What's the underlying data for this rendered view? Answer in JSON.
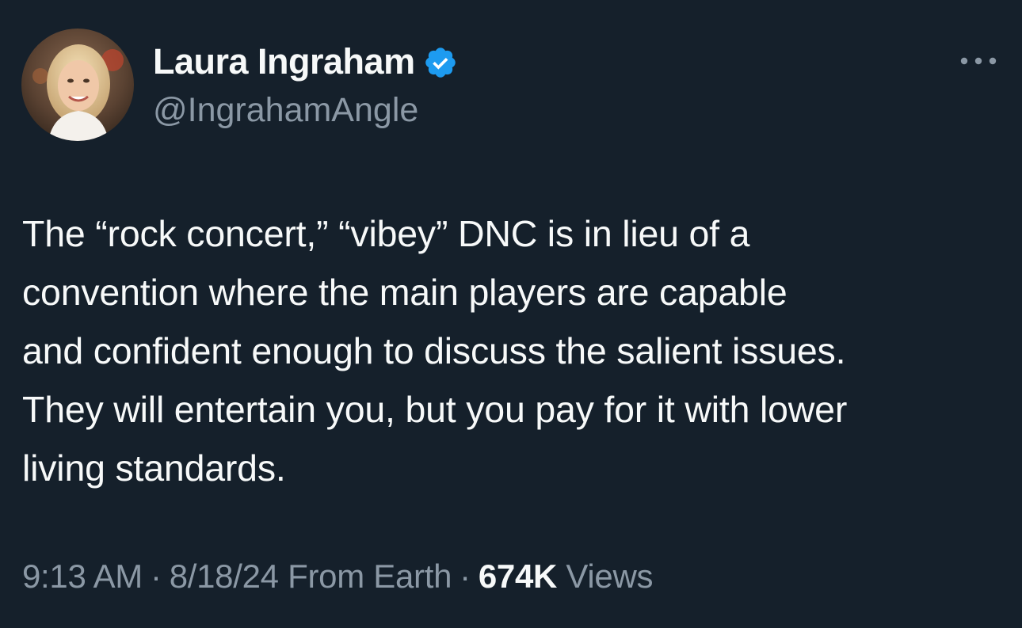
{
  "author": {
    "display_name": "Laura Ingraham",
    "handle": "@IngrahamAngle",
    "verified": true,
    "verified_color": "#1d9bf0"
  },
  "tweet": {
    "text": "The “rock concert,” “vibey” DNC is in lieu of a\nconvention where the main players are capable\nand confident enough to discuss the salient issues.\nThey will entertain you, but you pay for it with lower\nliving standards."
  },
  "meta": {
    "time": "9:13 AM",
    "separator": "·",
    "date": "8/18/24",
    "source": "From Earth",
    "views_count": "674K",
    "views_label": "Views"
  },
  "icons": {
    "avatar": "avatar",
    "verified": "verified-badge-icon",
    "more": "more-options-icon"
  },
  "colors": {
    "background": "#15202b",
    "primary_text": "#f7f9f9",
    "secondary_text": "#8b98a5",
    "accent": "#1d9bf0"
  }
}
